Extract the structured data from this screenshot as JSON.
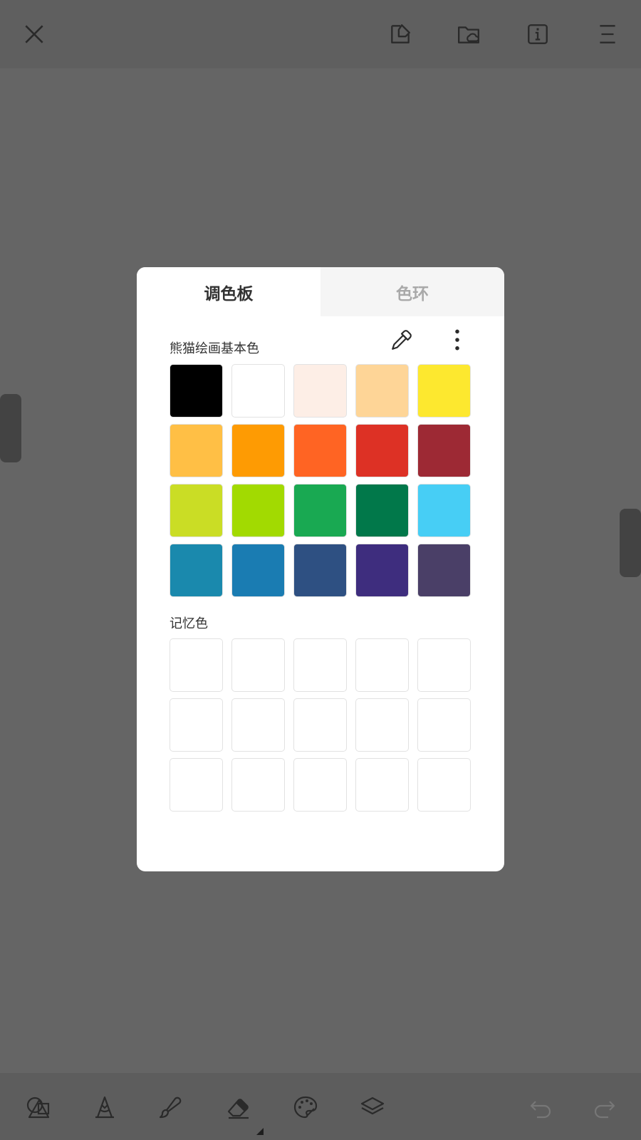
{
  "dialog": {
    "tabs": [
      {
        "label": "调色板",
        "active": true
      },
      {
        "label": "色环",
        "active": false
      }
    ],
    "basic_colors_label": "熊猫绘画基本色",
    "memory_colors_label": "记忆色",
    "basic_colors": [
      "#000000",
      "#ffffff",
      "#fdeee6",
      "#fed597",
      "#fde82f",
      "#ffbf45",
      "#fe9b03",
      "#ff6423",
      "#dd3125",
      "#9d2934",
      "#cadd25",
      "#a2da01",
      "#19a952",
      "#01784a",
      "#47cef5",
      "#1a89ad",
      "#1a7cb2",
      "#2e5082",
      "#3e2d7e",
      "#4a3f67"
    ],
    "memory_colors": [
      "#ffffff",
      "#ffffff",
      "#ffffff",
      "#ffffff",
      "#ffffff",
      "#ffffff",
      "#ffffff",
      "#ffffff",
      "#ffffff",
      "#ffffff",
      "#ffffff",
      "#ffffff",
      "#ffffff",
      "#ffffff",
      "#ffffff"
    ]
  },
  "topbar": {
    "icons": [
      "close-icon",
      "export-icon",
      "cloud-folder-icon",
      "info-icon",
      "menu-icon"
    ]
  },
  "bottombar": {
    "icons": [
      "shapes-icon",
      "pencil-icon",
      "brush-icon",
      "eraser-icon",
      "palette-icon",
      "layers-icon",
      "undo-icon",
      "redo-icon"
    ]
  },
  "colors": {
    "overlay": "#656565",
    "icon_dark": "#2a2a2a",
    "icon_disabled": "#777777"
  }
}
